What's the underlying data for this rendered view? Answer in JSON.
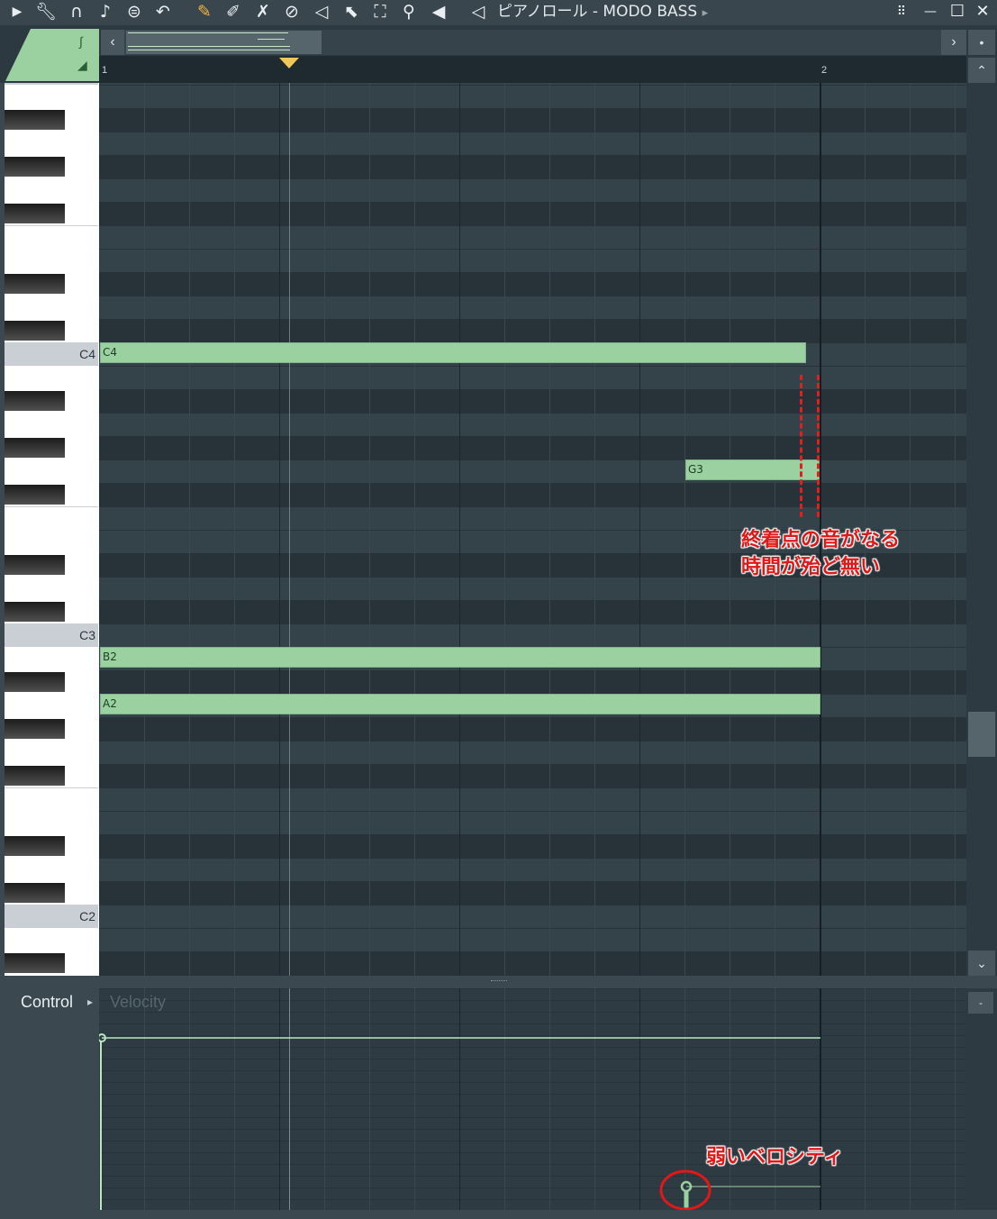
{
  "toolbar": {
    "icons": [
      "play-arrow-icon",
      "wrench-icon",
      "magnet-icon",
      "note-icon",
      "stamp-icon",
      "undo-icon",
      "pencil-icon",
      "paint-icon",
      "delete-icon",
      "mute-icon",
      "slip-icon",
      "select-icon",
      "zoom-icon",
      "playback-icon",
      "speaker-icon"
    ],
    "title": "ピアノロール - MODO BASS",
    "title_arrow": "▸",
    "window_buttons": {
      "detach": "⠿",
      "minimize": "—",
      "maximize": "☐",
      "close": "✕"
    }
  },
  "navigator": {
    "left": "‹",
    "right": "›",
    "menu": "•"
  },
  "ruler": {
    "bar1": "1",
    "bar2": "2"
  },
  "scroll": {
    "up": "⌃",
    "down": "⌄"
  },
  "piano": {
    "c4": "C4",
    "c3": "C3",
    "c2": "C2"
  },
  "notes": {
    "c4": {
      "label": "C4",
      "pitch": "C4",
      "start": 1.0,
      "end": 1.98
    },
    "g3": {
      "label": "G3",
      "pitch": "G3",
      "start": 1.8125,
      "end": 2.0
    },
    "b2": {
      "label": "B2",
      "pitch": "B2",
      "start": 1.0,
      "end": 2.0
    },
    "a2": {
      "label": "A2",
      "pitch": "A2",
      "start": 1.0,
      "end": 2.0
    }
  },
  "annotations": {
    "end_point": {
      "line1": "終着点の音がなる",
      "line2": "時間が殆ど無い",
      "color": "#e01818"
    },
    "velocity": {
      "text": "弱いベロシティ",
      "color": "#e01818"
    }
  },
  "control": {
    "label": "Control",
    "arrow": "▸",
    "param": "Velocity",
    "button": "-"
  },
  "colors": {
    "note": "#9bd1a1",
    "accent": "#9bd1a1",
    "grid_bg": "#2f3b42"
  }
}
